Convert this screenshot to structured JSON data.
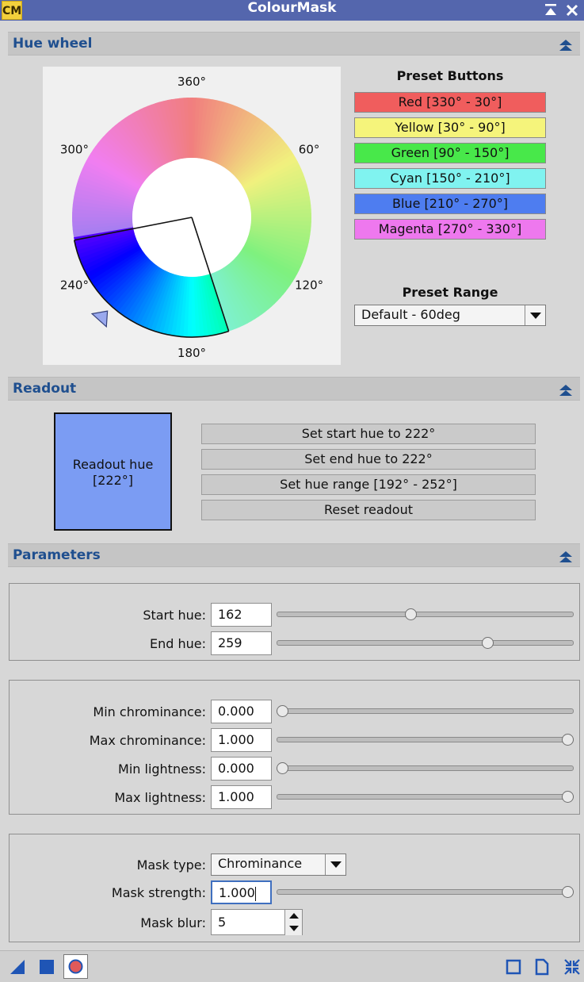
{
  "window": {
    "title": "ColourMask",
    "logo_text": "CM"
  },
  "sections": {
    "hue_wheel": "Hue wheel",
    "readout": "Readout",
    "parameters": "Parameters"
  },
  "hue_wheel": {
    "labels": [
      "360°",
      "60°",
      "120°",
      "180°",
      "240°",
      "300°"
    ],
    "selected_range": {
      "start": 162,
      "end": 259
    },
    "marker_hue": 222
  },
  "presets": {
    "title": "Preset Buttons",
    "buttons": [
      {
        "label": "Red [330° - 30°]",
        "color": "#f05d5d"
      },
      {
        "label": "Yellow [30° - 90°]",
        "color": "#f5f47b"
      },
      {
        "label": "Green [90° - 150°]",
        "color": "#48e84a"
      },
      {
        "label": "Cyan [150° - 210°]",
        "color": "#80f3f0"
      },
      {
        "label": "Blue [210° - 270°]",
        "color": "#4e7df0"
      },
      {
        "label": "Magenta [270° - 330°]",
        "color": "#ee78ee"
      }
    ],
    "range_title": "Preset Range",
    "range_value": "Default - 60deg"
  },
  "readout": {
    "swatch_text": "Readout hue\n[222°]",
    "swatch_color": "#7b9cf3",
    "buttons": [
      "Set start hue to 222°",
      "Set end hue to 222°",
      "Set hue range [192° - 252°]",
      "Reset readout"
    ]
  },
  "parameters": {
    "start_hue": {
      "label": "Start hue:",
      "value": "162",
      "slider_fraction": 0.45
    },
    "end_hue": {
      "label": "End hue:",
      "value": "259",
      "slider_fraction": 0.72
    },
    "min_chrominance": {
      "label": "Min chrominance:",
      "value": "0.000",
      "slider_fraction": 0.0
    },
    "max_chrominance": {
      "label": "Max chrominance:",
      "value": "1.000",
      "slider_fraction": 1.0
    },
    "min_lightness": {
      "label": "Min lightness:",
      "value": "0.000",
      "slider_fraction": 0.0
    },
    "max_lightness": {
      "label": "Max lightness:",
      "value": "1.000",
      "slider_fraction": 1.0
    },
    "mask_type": {
      "label": "Mask type:",
      "value": "Chrominance"
    },
    "mask_strength": {
      "label": "Mask strength:",
      "value": "1.000",
      "slider_fraction": 1.0
    },
    "mask_blur": {
      "label": "Mask blur:",
      "value": "5"
    }
  },
  "toolbar": {
    "left_icons": [
      "new-instance-icon",
      "apply-global-icon",
      "realtime-preview-icon"
    ],
    "right_icons": [
      "documentation-icon",
      "browse-documentation-icon",
      "reset-icon"
    ]
  }
}
